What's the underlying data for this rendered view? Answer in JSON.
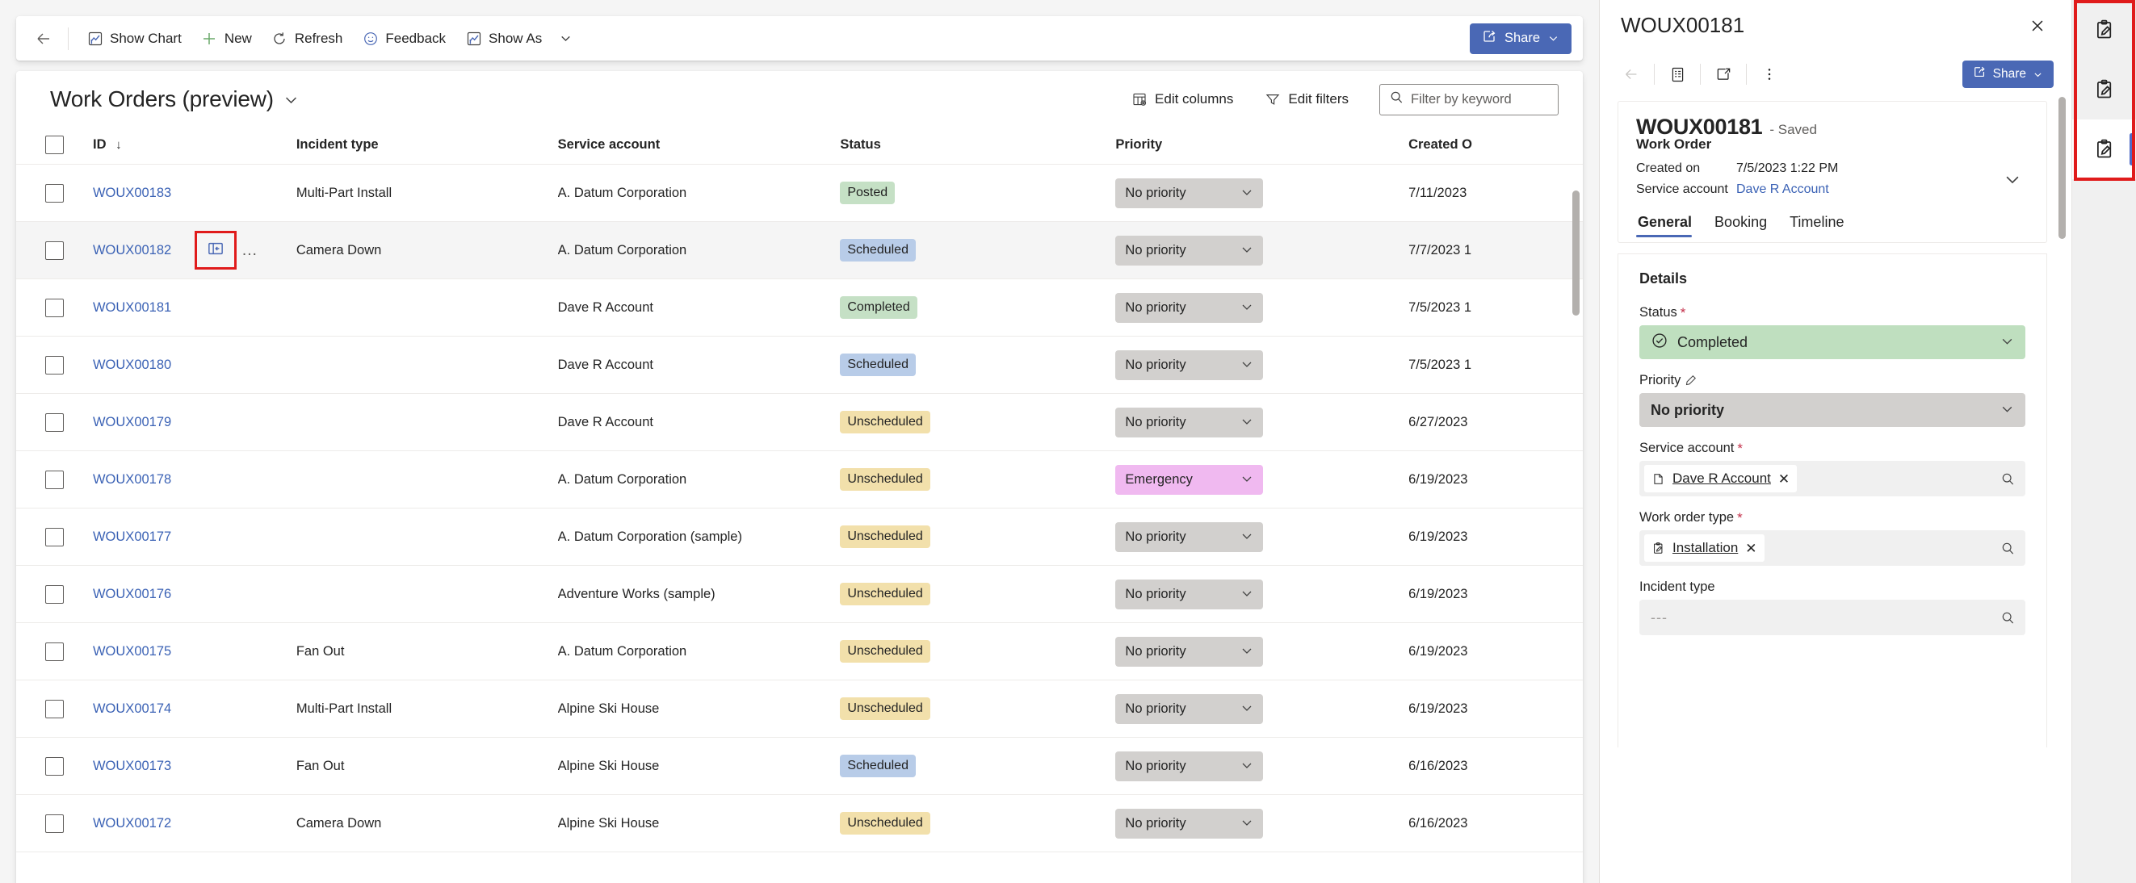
{
  "commandbar": {
    "back_label": "Back",
    "buttons": [
      {
        "label": "Show Chart",
        "icon": "chart-icon"
      },
      {
        "label": "New",
        "icon": "plus-icon"
      },
      {
        "label": "Refresh",
        "icon": "refresh-icon"
      },
      {
        "label": "Feedback",
        "icon": "feedback-icon"
      },
      {
        "label": "Show As",
        "icon": "chart-icon"
      }
    ],
    "share_label": "Share"
  },
  "list": {
    "view_title": "Work Orders (preview)",
    "edit_columns_label": "Edit columns",
    "edit_filters_label": "Edit filters",
    "search_placeholder": "Filter by keyword",
    "search_value": "",
    "columns": [
      "ID",
      "Incident type",
      "Service account",
      "Status",
      "Priority",
      "Created O"
    ],
    "sort_column": "ID",
    "sort_direction": "desc",
    "rows": [
      {
        "id": "WOUX00183",
        "incident_type": "Multi-Part Install",
        "service_account": "A. Datum Corporation",
        "status": "Posted",
        "status_kind": "posted",
        "priority": "No priority",
        "priority_kind": "none",
        "created_on": "7/11/2023",
        "selected": false,
        "hovered": false
      },
      {
        "id": "WOUX00182",
        "incident_type": "Camera Down",
        "service_account": "A. Datum Corporation",
        "status": "Scheduled",
        "status_kind": "scheduled",
        "priority": "No priority",
        "priority_kind": "none",
        "created_on": "7/7/2023 1",
        "selected": false,
        "hovered": true
      },
      {
        "id": "WOUX00181",
        "incident_type": "",
        "service_account": "Dave R Account",
        "status": "Completed",
        "status_kind": "completed",
        "priority": "No priority",
        "priority_kind": "none",
        "created_on": "7/5/2023 1",
        "selected": false,
        "hovered": false
      },
      {
        "id": "WOUX00180",
        "incident_type": "",
        "service_account": "Dave R Account",
        "status": "Scheduled",
        "status_kind": "scheduled",
        "priority": "No priority",
        "priority_kind": "none",
        "created_on": "7/5/2023 1",
        "selected": false,
        "hovered": false
      },
      {
        "id": "WOUX00179",
        "incident_type": "",
        "service_account": "Dave R Account",
        "status": "Unscheduled",
        "status_kind": "unscheduled",
        "priority": "No priority",
        "priority_kind": "none",
        "created_on": "6/27/2023",
        "selected": false,
        "hovered": false
      },
      {
        "id": "WOUX00178",
        "incident_type": "",
        "service_account": "A. Datum Corporation",
        "status": "Unscheduled",
        "status_kind": "unscheduled",
        "priority": "Emergency",
        "priority_kind": "emergency",
        "created_on": "6/19/2023",
        "selected": false,
        "hovered": false
      },
      {
        "id": "WOUX00177",
        "incident_type": "",
        "service_account": "A. Datum Corporation (sample)",
        "status": "Unscheduled",
        "status_kind": "unscheduled",
        "priority": "No priority",
        "priority_kind": "none",
        "created_on": "6/19/2023",
        "selected": false,
        "hovered": false
      },
      {
        "id": "WOUX00176",
        "incident_type": "",
        "service_account": "Adventure Works (sample)",
        "status": "Unscheduled",
        "status_kind": "unscheduled",
        "priority": "No priority",
        "priority_kind": "none",
        "created_on": "6/19/2023",
        "selected": false,
        "hovered": false
      },
      {
        "id": "WOUX00175",
        "incident_type": "Fan Out",
        "service_account": "A. Datum Corporation",
        "status": "Unscheduled",
        "status_kind": "unscheduled",
        "priority": "No priority",
        "priority_kind": "none",
        "created_on": "6/19/2023",
        "selected": false,
        "hovered": false
      },
      {
        "id": "WOUX00174",
        "incident_type": "Multi-Part Install",
        "service_account": "Alpine Ski House",
        "status": "Unscheduled",
        "status_kind": "unscheduled",
        "priority": "No priority",
        "priority_kind": "none",
        "created_on": "6/19/2023",
        "selected": false,
        "hovered": false
      },
      {
        "id": "WOUX00173",
        "incident_type": "Fan Out",
        "service_account": "Alpine Ski House",
        "status": "Scheduled",
        "status_kind": "scheduled",
        "priority": "No priority",
        "priority_kind": "none",
        "created_on": "6/16/2023",
        "selected": false,
        "hovered": false
      },
      {
        "id": "WOUX00172",
        "incident_type": "Camera Down",
        "service_account": "Alpine Ski House",
        "status": "Unscheduled",
        "status_kind": "unscheduled",
        "priority": "No priority",
        "priority_kind": "none",
        "created_on": "6/16/2023",
        "selected": false,
        "hovered": false
      }
    ],
    "row_command_icon": "open-side-panel-icon",
    "row_overflow_label": "…"
  },
  "side_panel": {
    "header_title": "WOUX00181",
    "close_label": "Close",
    "toolbar": {
      "back_icon": "back-arrow-icon",
      "form_icon": "form-icon",
      "popout_icon": "pop-out-icon",
      "more_icon": "more-vertical-icon",
      "share_label": "Share"
    },
    "record": {
      "name": "WOUX00181",
      "saved_state": "- Saved",
      "entity": "Work Order",
      "fields": [
        {
          "label": "Created on",
          "value": "7/5/2023 1:22 PM",
          "is_link": false
        },
        {
          "label": "Service account",
          "value": "Dave R Account",
          "is_link": true
        }
      ]
    },
    "tabs": [
      {
        "label": "General",
        "active": true
      },
      {
        "label": "Booking",
        "active": false
      },
      {
        "label": "Timeline",
        "active": false
      }
    ],
    "section_title": "Details",
    "form_fields": [
      {
        "label": "Status",
        "required": true,
        "type": "select",
        "value": "Completed",
        "style": "green",
        "icon": "check-circle-icon"
      },
      {
        "label": "Priority",
        "required": false,
        "has_pencil": true,
        "type": "select",
        "value": "No priority",
        "style": "gray",
        "icon": ""
      },
      {
        "label": "Service account",
        "required": true,
        "type": "lookup",
        "value": "Dave R Account",
        "chip_icon": "account-icon",
        "empty": false
      },
      {
        "label": "Work order type",
        "required": true,
        "type": "lookup",
        "value": "Installation",
        "chip_icon": "clipboard-pencil-icon",
        "empty": false
      },
      {
        "label": "Incident type",
        "required": false,
        "type": "lookup",
        "value": "---",
        "chip_icon": "",
        "empty": true
      }
    ]
  },
  "rail": {
    "items": [
      {
        "icon": "clipboard-pencil-icon",
        "active": false
      },
      {
        "icon": "clipboard-pencil-icon",
        "active": false
      },
      {
        "icon": "clipboard-pencil-icon",
        "active": true
      }
    ]
  },
  "colors": {
    "accent": "#4a68b5",
    "link": "#3b62b5",
    "highlight_box": "#e01b1b",
    "status_posted": "#c5e0c5",
    "status_scheduled": "#b8cce8",
    "status_completed": "#c5e0c5",
    "status_unscheduled": "#f2e0ab",
    "priority_none": "#d2d0ce",
    "priority_emergency": "#f0b9f0"
  }
}
